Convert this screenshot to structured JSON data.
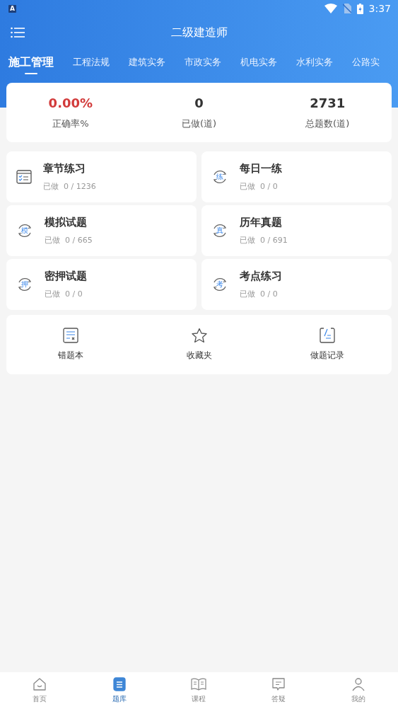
{
  "status_bar": {
    "notification": "A",
    "time": "3:37"
  },
  "header": {
    "title": "二级建造师"
  },
  "tabs": [
    {
      "label": "施工管理",
      "selected": true
    },
    {
      "label": "工程法规",
      "selected": false
    },
    {
      "label": "建筑实务",
      "selected": false
    },
    {
      "label": "市政实务",
      "selected": false
    },
    {
      "label": "机电实务",
      "selected": false
    },
    {
      "label": "水利实务",
      "selected": false
    },
    {
      "label": "公路实",
      "selected": false
    }
  ],
  "stats": [
    {
      "value": "0.00%",
      "label": "正确率%",
      "kind": "rate"
    },
    {
      "value": "0",
      "label": "已做(道)",
      "kind": "count"
    },
    {
      "value": "2731",
      "label": "总题数(道)",
      "kind": "count"
    }
  ],
  "practice_cards": [
    {
      "kind": "list",
      "title": "章节练习",
      "progress": "已做  0 / 1236"
    },
    {
      "kind": "char",
      "icon_char": "练",
      "title": "每日一练",
      "progress": "已做  0 / 0"
    },
    {
      "kind": "char",
      "icon_char": "模",
      "title": "模拟试题",
      "progress": "已做  0 / 665"
    },
    {
      "kind": "char",
      "icon_char": "真",
      "title": "历年真题",
      "progress": "已做  0 / 691"
    },
    {
      "kind": "char",
      "icon_char": "押",
      "title": "密押试题",
      "progress": "已做  0 / 0"
    },
    {
      "kind": "char",
      "icon_char": "考",
      "title": "考点练习",
      "progress": "已做  0 / 0"
    }
  ],
  "tools": [
    {
      "kind": "wrong",
      "label": "错题本"
    },
    {
      "kind": "star",
      "label": "收藏夹"
    },
    {
      "kind": "record",
      "label": "做题记录"
    }
  ],
  "bottom_nav": [
    {
      "kind": "home",
      "label": "首页",
      "selected": false
    },
    {
      "kind": "bank",
      "label": "题库",
      "selected": true
    },
    {
      "kind": "course",
      "label": "课程",
      "selected": false
    },
    {
      "kind": "qa",
      "label": "答疑",
      "selected": false
    },
    {
      "kind": "me",
      "label": "我的",
      "selected": false
    }
  ]
}
